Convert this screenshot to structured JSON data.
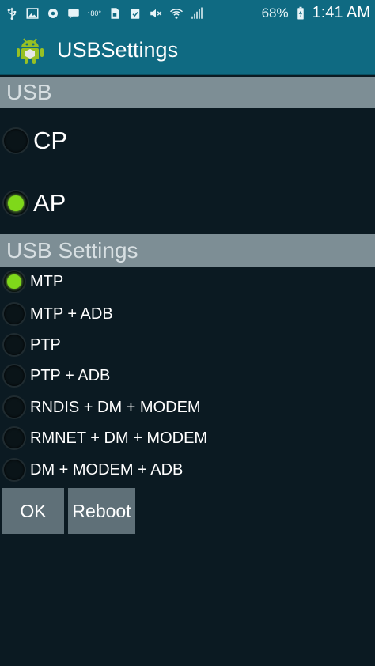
{
  "status_bar": {
    "icons": [
      "usb-icon",
      "gallery-icon",
      "notification-icon",
      "message-icon",
      "weather-icon",
      "sim-icon",
      "clipboard-icon",
      "mute-icon",
      "wifi-icon",
      "signal-icon"
    ],
    "temperature": "80°",
    "battery": "68%",
    "time": "1:41 AM"
  },
  "app_bar": {
    "title": "USBSettings",
    "icon": "android-icon"
  },
  "sections": {
    "usb": {
      "header": "USB",
      "options": [
        {
          "label": "CP",
          "selected": false
        },
        {
          "label": "AP",
          "selected": true
        }
      ]
    },
    "usb_settings": {
      "header": "USB Settings",
      "options": [
        {
          "label": "MTP",
          "selected": true
        },
        {
          "label": "MTP + ADB",
          "selected": false
        },
        {
          "label": "PTP",
          "selected": false
        },
        {
          "label": "PTP + ADB",
          "selected": false
        },
        {
          "label": "RNDIS + DM + MODEM",
          "selected": false
        },
        {
          "label": "RMNET + DM + MODEM",
          "selected": false
        },
        {
          "label": "DM + MODEM + ADB",
          "selected": false
        }
      ]
    }
  },
  "buttons": {
    "ok": "OK",
    "reboot": "Reboot"
  },
  "colors": {
    "accent": "#0f6a82",
    "selected": "#7fd81a",
    "header": "#7d8e95",
    "background": "#0b1a22",
    "button": "#5f7078"
  }
}
